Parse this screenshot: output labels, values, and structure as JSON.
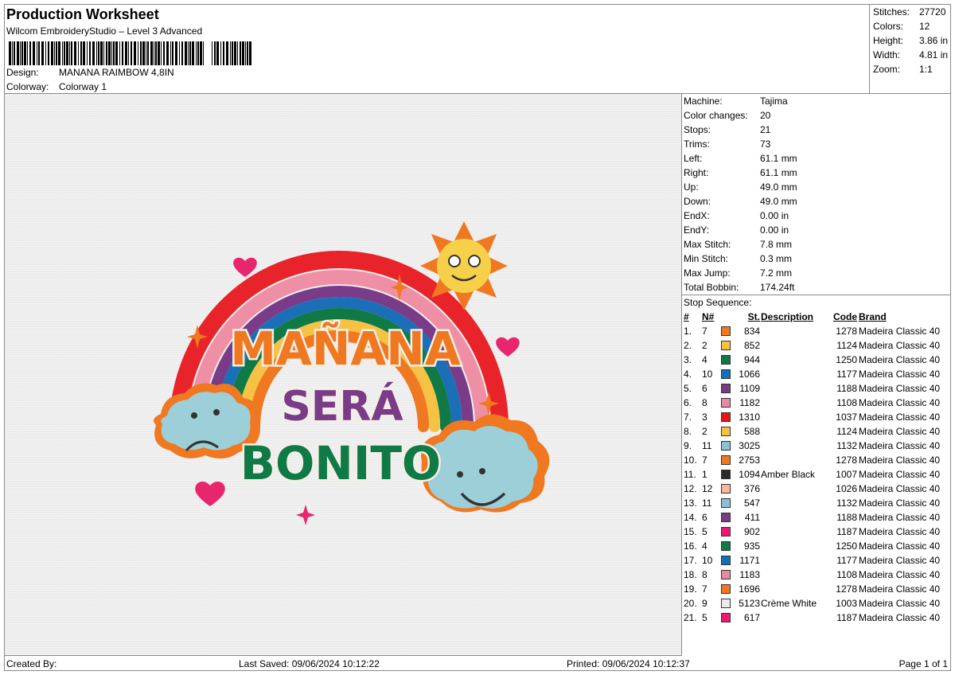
{
  "header": {
    "title": "Production Worksheet",
    "software": "Wilcom EmbroideryStudio – Level 3 Advanced",
    "design_label": "Design:",
    "design_value": "MANANA RAIMBOW 4,8IN",
    "colorway_label": "Colorway:",
    "colorway_value": "Colorway 1"
  },
  "stats": [
    {
      "label": "Stitches:",
      "value": "27720"
    },
    {
      "label": "Colors:",
      "value": "12"
    },
    {
      "label": "Height:",
      "value": "3.86 in"
    },
    {
      "label": "Width:",
      "value": "4.81 in"
    },
    {
      "label": "Zoom:",
      "value": "1:1"
    }
  ],
  "machine": [
    {
      "label": "Machine:",
      "value": "Tajima"
    },
    {
      "label": "Color changes:",
      "value": "20"
    },
    {
      "label": "Stops:",
      "value": "21"
    },
    {
      "label": "Trims:",
      "value": "73"
    },
    {
      "label": "Left:",
      "value": "61.1 mm"
    },
    {
      "label": "Right:",
      "value": "61.1 mm"
    },
    {
      "label": "Up:",
      "value": "49.0 mm"
    },
    {
      "label": "Down:",
      "value": "49.0 mm"
    },
    {
      "label": "EndX:",
      "value": "0.00 in"
    },
    {
      "label": "EndY:",
      "value": "0.00 in"
    },
    {
      "label": "Max Stitch:",
      "value": "7.8 mm"
    },
    {
      "label": "Min Stitch:",
      "value": "0.3 mm"
    },
    {
      "label": "Max Jump:",
      "value": "7.2 mm"
    },
    {
      "label": "Total Bobbin:",
      "value": "174.24ft"
    }
  ],
  "stop_sequence": {
    "caption": "Stop Sequence:",
    "headers": {
      "num": "#",
      "n": "N#",
      "st": "St.",
      "desc": "Description",
      "code": "Code",
      "brand": "Brand"
    },
    "rows": [
      {
        "num": "1.",
        "n": "7",
        "color": "#f07820",
        "st": "834",
        "desc": "",
        "code": "1278",
        "brand": "Madeira Classic 40"
      },
      {
        "num": "2.",
        "n": "2",
        "color": "#f7c244",
        "st": "852",
        "desc": "",
        "code": "1124",
        "brand": "Madeira Classic 40"
      },
      {
        "num": "3.",
        "n": "4",
        "color": "#0f7a45",
        "st": "944",
        "desc": "",
        "code": "1250",
        "brand": "Madeira Classic 40"
      },
      {
        "num": "4.",
        "n": "10",
        "color": "#1270b8",
        "st": "1066",
        "desc": "",
        "code": "1177",
        "brand": "Madeira Classic 40"
      },
      {
        "num": "5.",
        "n": "6",
        "color": "#7b3a86",
        "st": "1109",
        "desc": "",
        "code": "1188",
        "brand": "Madeira Classic 40"
      },
      {
        "num": "6.",
        "n": "8",
        "color": "#e98aa4",
        "st": "1182",
        "desc": "",
        "code": "1108",
        "brand": "Madeira Classic 40"
      },
      {
        "num": "7.",
        "n": "3",
        "color": "#e8141c",
        "st": "1310",
        "desc": "",
        "code": "1037",
        "brand": "Madeira Classic 40"
      },
      {
        "num": "8.",
        "n": "2",
        "color": "#f7c244",
        "st": "588",
        "desc": "",
        "code": "1124",
        "brand": "Madeira Classic 40"
      },
      {
        "num": "9.",
        "n": "11",
        "color": "#8dbfd6",
        "st": "3025",
        "desc": "",
        "code": "1132",
        "brand": "Madeira Classic 40"
      },
      {
        "num": "10.",
        "n": "7",
        "color": "#f07820",
        "st": "2753",
        "desc": "",
        "code": "1278",
        "brand": "Madeira Classic 40"
      },
      {
        "num": "11.",
        "n": "1",
        "color": "#2a2a2a",
        "st": "1094",
        "desc": "Amber Black",
        "code": "1007",
        "brand": "Madeira Classic 40"
      },
      {
        "num": "12.",
        "n": "12",
        "color": "#f7b99a",
        "st": "376",
        "desc": "",
        "code": "1026",
        "brand": "Madeira Classic 40"
      },
      {
        "num": "13.",
        "n": "11",
        "color": "#8dbfd6",
        "st": "547",
        "desc": "",
        "code": "1132",
        "brand": "Madeira Classic 40"
      },
      {
        "num": "14.",
        "n": "6",
        "color": "#7b3a86",
        "st": "411",
        "desc": "",
        "code": "1188",
        "brand": "Madeira Classic 40"
      },
      {
        "num": "15.",
        "n": "5",
        "color": "#ee1777",
        "st": "902",
        "desc": "",
        "code": "1187",
        "brand": "Madeira Classic 40"
      },
      {
        "num": "16.",
        "n": "4",
        "color": "#0f7a45",
        "st": "935",
        "desc": "",
        "code": "1250",
        "brand": "Madeira Classic 40"
      },
      {
        "num": "17.",
        "n": "10",
        "color": "#1270b8",
        "st": "1171",
        "desc": "",
        "code": "1177",
        "brand": "Madeira Classic 40"
      },
      {
        "num": "18.",
        "n": "8",
        "color": "#e98aa4",
        "st": "1183",
        "desc": "",
        "code": "1108",
        "brand": "Madeira Classic 40"
      },
      {
        "num": "19.",
        "n": "7",
        "color": "#f07820",
        "st": "1696",
        "desc": "",
        "code": "1278",
        "brand": "Madeira Classic 40"
      },
      {
        "num": "20.",
        "n": "9",
        "color": "#ececec",
        "st": "5123",
        "desc": "Crème White",
        "code": "1003",
        "brand": "Madeira Classic 40"
      },
      {
        "num": "21.",
        "n": "5",
        "color": "#ee1777",
        "st": "617",
        "desc": "",
        "code": "1187",
        "brand": "Madeira Classic 40"
      }
    ]
  },
  "design_art": {
    "line1": "MAÑANA",
    "line2": "SERÁ",
    "line3": "BONITO"
  },
  "footer": {
    "created_by": "Created By:",
    "last_saved": "Last Saved: 09/06/2024 10:12:22",
    "printed": "Printed: 09/06/2024 10:12:37",
    "page": "Page 1 of 1"
  }
}
